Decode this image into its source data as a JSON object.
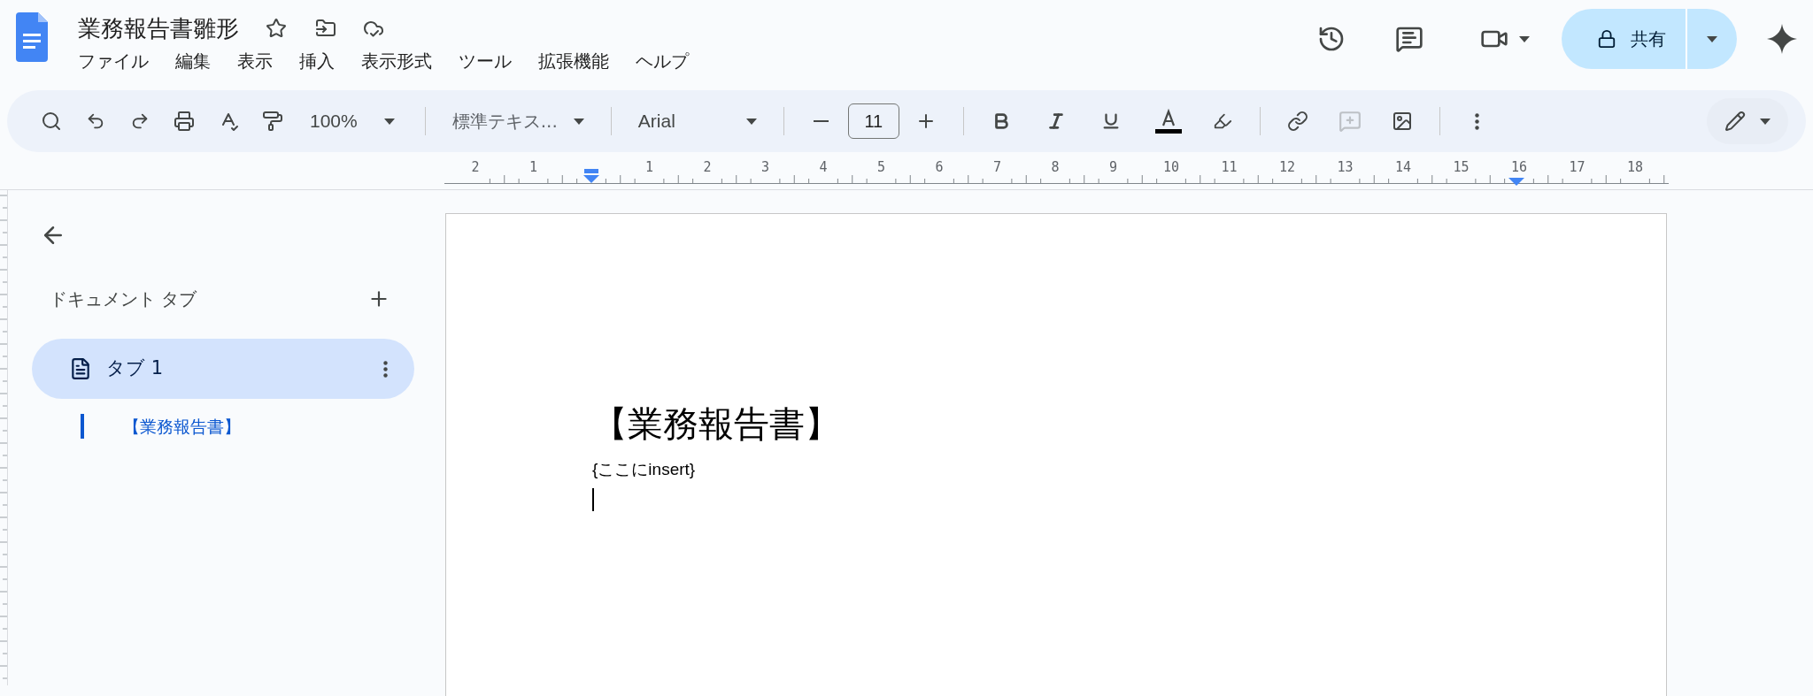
{
  "document_title": "業務報告書雛形",
  "menu": [
    "ファイル",
    "編集",
    "表示",
    "挿入",
    "表示形式",
    "ツール",
    "拡張機能",
    "ヘルプ"
  ],
  "share_button": "共有",
  "toolbar": {
    "zoom": "100%",
    "style": "標準テキス...",
    "font": "Arial",
    "font_size": "11"
  },
  "ruler": {
    "labels": [
      "2",
      "1",
      "1",
      "2",
      "3",
      "4",
      "5",
      "6",
      "7",
      "8",
      "9",
      "10",
      "11",
      "12",
      "13",
      "14",
      "15",
      "16",
      "17",
      "18"
    ]
  },
  "sidebar": {
    "heading": "ドキュメント タブ",
    "tabs": [
      {
        "label": "タブ 1",
        "selected": true,
        "outline": [
          {
            "text": "【業務報告書】",
            "selected": true
          }
        ]
      }
    ]
  },
  "document": {
    "heading": "【業務報告書】",
    "body": "{ここにinsert}"
  }
}
